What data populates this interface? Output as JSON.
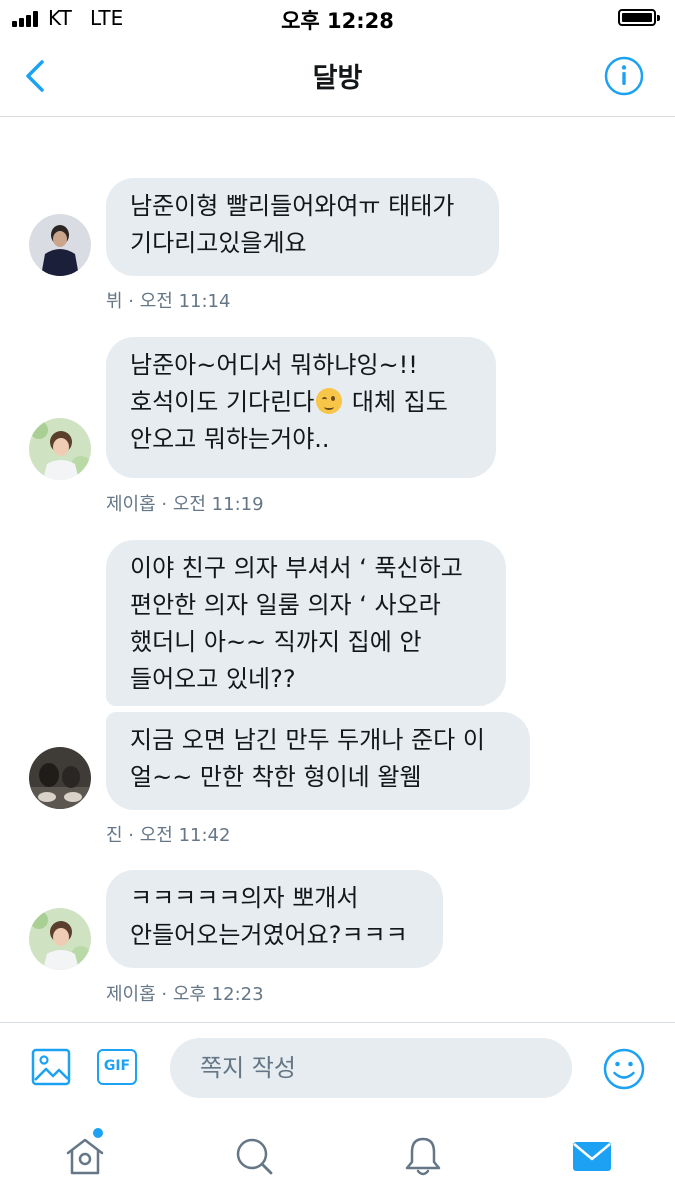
{
  "status_bar": {
    "carrier": "KT",
    "network": "LTE",
    "time": "오후 12:28"
  },
  "header": {
    "title": "달방",
    "back_icon": "chevron-left-icon",
    "info_icon": "info-icon"
  },
  "messages": [
    {
      "lines": [
        "남준이형 빨리들어와여ㅠ 태태가",
        "기다리고있을게요"
      ],
      "meta": "뷔 · 오전 11:14"
    },
    {
      "lines": [
        "남준아~어디서 뭐하냐잉~!!",
        "호석이도 기다린다",
        " 대체 집도",
        "안오고 뭐하는거야.."
      ],
      "meta": "제이홉 · 오전 11:19"
    },
    {
      "lines": [
        "이야 친구 의자 부셔서 ‘ 푹신하고",
        "편안한 의자 일룸 의자 ‘ 사오라",
        "했더니 아~~ 직까지 집에 안",
        "들어오고 있네??"
      ],
      "meta": ""
    },
    {
      "lines": [
        "지금 오면 남긴 만두 두개나 준다 이",
        "얼~~ 만한 착한 형이네 왈웸"
      ],
      "meta": "진 · 오전 11:42"
    },
    {
      "lines": [
        "ㅋㅋㅋㅋㅋ의자 뽀개서",
        "안들어오는거였어요?ㅋㅋㅋ"
      ],
      "meta": "제이홉 · 오후 12:23"
    }
  ],
  "composer": {
    "placeholder": "쪽지 작성",
    "gif_label": "GIF",
    "media_icon": "image-icon",
    "emoji_icon": "smiley-icon"
  },
  "tabbar": {
    "items": [
      "home-icon",
      "search-icon",
      "notifications-icon",
      "messages-icon"
    ],
    "active": "messages-icon"
  },
  "colors": {
    "accent": "#1da1f2",
    "bubble": "#e6ecf0",
    "meta_text": "#657786",
    "divider": "#d8dde2"
  }
}
